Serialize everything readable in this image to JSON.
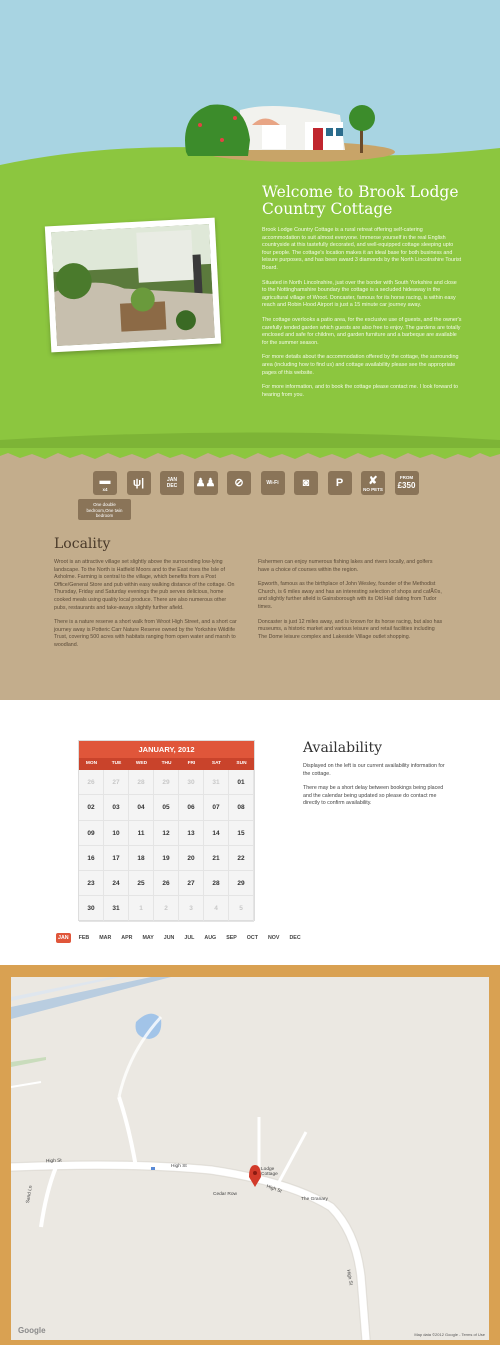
{
  "welcome": {
    "title": "Welcome to Brook Lodge Country Cottage",
    "paragraphs": [
      "Brook Lodge Country Cottage is a rural retreat offering self-catering accommodation to suit almost everyone. Immerse yourself in the real English countryside at this tastefully decorated, and well-equipped cottage sleeping upto four people. The cottage's location makes it an ideal base for both business and leisure purposes, and has been award 3 diamonds by the North Lincolnshire Tourist Board.",
      "Situated in North Lincolnshire, just over the border with South Yorkshire and close to the Nottinghamshire boundary the cottage is a secluded hideaway in the agricultural village of Wroot. Doncaster, famous for its horse racing, is within easy reach and Robin Hood Airport is just a 15 minute car journey away.",
      "The cottage overlooks a patio area, for the exclusive use of guests, and the owner's carefully tended garden which guests are also free to enjoy. The gardens are totally enclosed and safe for children, and garden furniture and a barbeque are available for the summer season.",
      "For more details about the accommodation offered by the cottage, the surrounding area (including how to find us) and cottage availability please see the appropriate pages of this website.",
      "For more information, and to book the cottage please contact me. I look forward to hearing from you."
    ]
  },
  "amenities": [
    {
      "icon": "bed-icon",
      "sym": "▬",
      "sub": "x4"
    },
    {
      "icon": "cutlery-icon",
      "sym": "ψ|",
      "sub": ""
    },
    {
      "icon": "calendar-range-icon",
      "sym": "",
      "sub": "JAN\nDEC"
    },
    {
      "icon": "family-icon",
      "sym": "♟♟",
      "sub": ""
    },
    {
      "icon": "no-smoking-icon",
      "sym": "⊘",
      "sub": ""
    },
    {
      "icon": "wifi-icon",
      "sym": "",
      "sub": "Wi-Fi"
    },
    {
      "icon": "washing-machine-icon",
      "sym": "◙",
      "sub": ""
    },
    {
      "icon": "parking-icon",
      "sym": "P",
      "sub": ""
    },
    {
      "icon": "no-pets-icon",
      "sym": "✘",
      "sub": "NO PETS"
    },
    {
      "icon": "price-icon",
      "sym": "£350",
      "sub": "FROM"
    }
  ],
  "bed_tooltip": "One double bedroom,One twin bedroom",
  "locality": {
    "title": "Locality",
    "left": [
      "Wroot is an attractive village set slightly above the surrounding low-lying landscape. To the North is Hatfield Moors and to the East rises the Isle of Axholme. Farming is central to the village, which benefits from a Post Office/General Store and pub within easy walking distance of the cottage. On Thursday, Friday and Saturday evenings the pub serves delicious, home cooked meals using quality local produce. There are also numerous other pubs, restaurants and take-aways slightly further afield.",
      "There is a nature reserve a short walk from Wroot High Street, and a short car journey away is Potteric Carr Nature Reserve owned by the Yorkshire Wildlife Trust, covering 500 acres with habitats ranging from open water and marsh to woodland."
    ],
    "right": [
      "Fishermen can enjoy numerous fishing lakes and rivers locally, and golfers have a choice of courses within the region.",
      "Epworth, famous as the birthplace of John Wesley, founder of the Methodist Church, is 6 miles away and has an interesting selection of shops and cafÃ©s, and slightly further afield is Gainsborough with its Old Hall dating from Tudor times.",
      "Doncaster is just 12 miles away, and is known for its horse racing, but also has museums, a historic market and various leisure and retail facilities including The Dome leisure complex and Lakeside Village outlet shopping."
    ]
  },
  "calendar": {
    "title": "JANUARY, 2012",
    "days_of_week": [
      "MON",
      "TUE",
      "WED",
      "THU",
      "FRI",
      "SAT",
      "SUN"
    ],
    "days": [
      {
        "d": "26",
        "m": true
      },
      {
        "d": "27",
        "m": true
      },
      {
        "d": "28",
        "m": true
      },
      {
        "d": "29",
        "m": true
      },
      {
        "d": "30",
        "m": true
      },
      {
        "d": "31",
        "m": true
      },
      {
        "d": "01",
        "m": false
      },
      {
        "d": "02",
        "m": false
      },
      {
        "d": "03",
        "m": false
      },
      {
        "d": "04",
        "m": false
      },
      {
        "d": "05",
        "m": false
      },
      {
        "d": "06",
        "m": false
      },
      {
        "d": "07",
        "m": false
      },
      {
        "d": "08",
        "m": false
      },
      {
        "d": "09",
        "m": false
      },
      {
        "d": "10",
        "m": false
      },
      {
        "d": "11",
        "m": false
      },
      {
        "d": "12",
        "m": false
      },
      {
        "d": "13",
        "m": false
      },
      {
        "d": "14",
        "m": false
      },
      {
        "d": "15",
        "m": false
      },
      {
        "d": "16",
        "m": false
      },
      {
        "d": "17",
        "m": false
      },
      {
        "d": "18",
        "m": false
      },
      {
        "d": "19",
        "m": false
      },
      {
        "d": "20",
        "m": false
      },
      {
        "d": "21",
        "m": false
      },
      {
        "d": "22",
        "m": false
      },
      {
        "d": "23",
        "m": false
      },
      {
        "d": "24",
        "m": false
      },
      {
        "d": "25",
        "m": false
      },
      {
        "d": "26",
        "m": false
      },
      {
        "d": "27",
        "m": false
      },
      {
        "d": "28",
        "m": false
      },
      {
        "d": "29",
        "m": false
      },
      {
        "d": "30",
        "m": false
      },
      {
        "d": "31",
        "m": false
      },
      {
        "d": "1",
        "m": true
      },
      {
        "d": "2",
        "m": true
      },
      {
        "d": "3",
        "m": true
      },
      {
        "d": "4",
        "m": true
      },
      {
        "d": "5",
        "m": true
      }
    ],
    "months": [
      "JAN",
      "FEB",
      "MAR",
      "APR",
      "MAY",
      "JUN",
      "JUL",
      "AUG",
      "SEP",
      "OCT",
      "NOV",
      "DEC"
    ],
    "active_month": "JAN"
  },
  "availability": {
    "title": "Availability",
    "paragraphs": [
      "Displayed on the left is our current availability information for the cottage.",
      "There may be a short delay between bookings being placed and the calendar being updated so please do contact me directly to confirm availability."
    ]
  },
  "map": {
    "labels": {
      "high_st_1": "High St",
      "high_st_2": "High St",
      "high_st_3": "High St",
      "high_st_4": "High St",
      "marker": "Lodge Cottage",
      "cedar_row": "Cedar Row",
      "granary": "The Granary",
      "side_road": "Sand Ln"
    },
    "google": "Google",
    "credit": "Map data ©2012 Google - Terms of Use"
  },
  "colors": {
    "sky": "#a8d4e2",
    "grass": "#8cc63f",
    "soil": "#c3ad8c",
    "accent": "#e0563a",
    "frame": "#d9a152"
  }
}
